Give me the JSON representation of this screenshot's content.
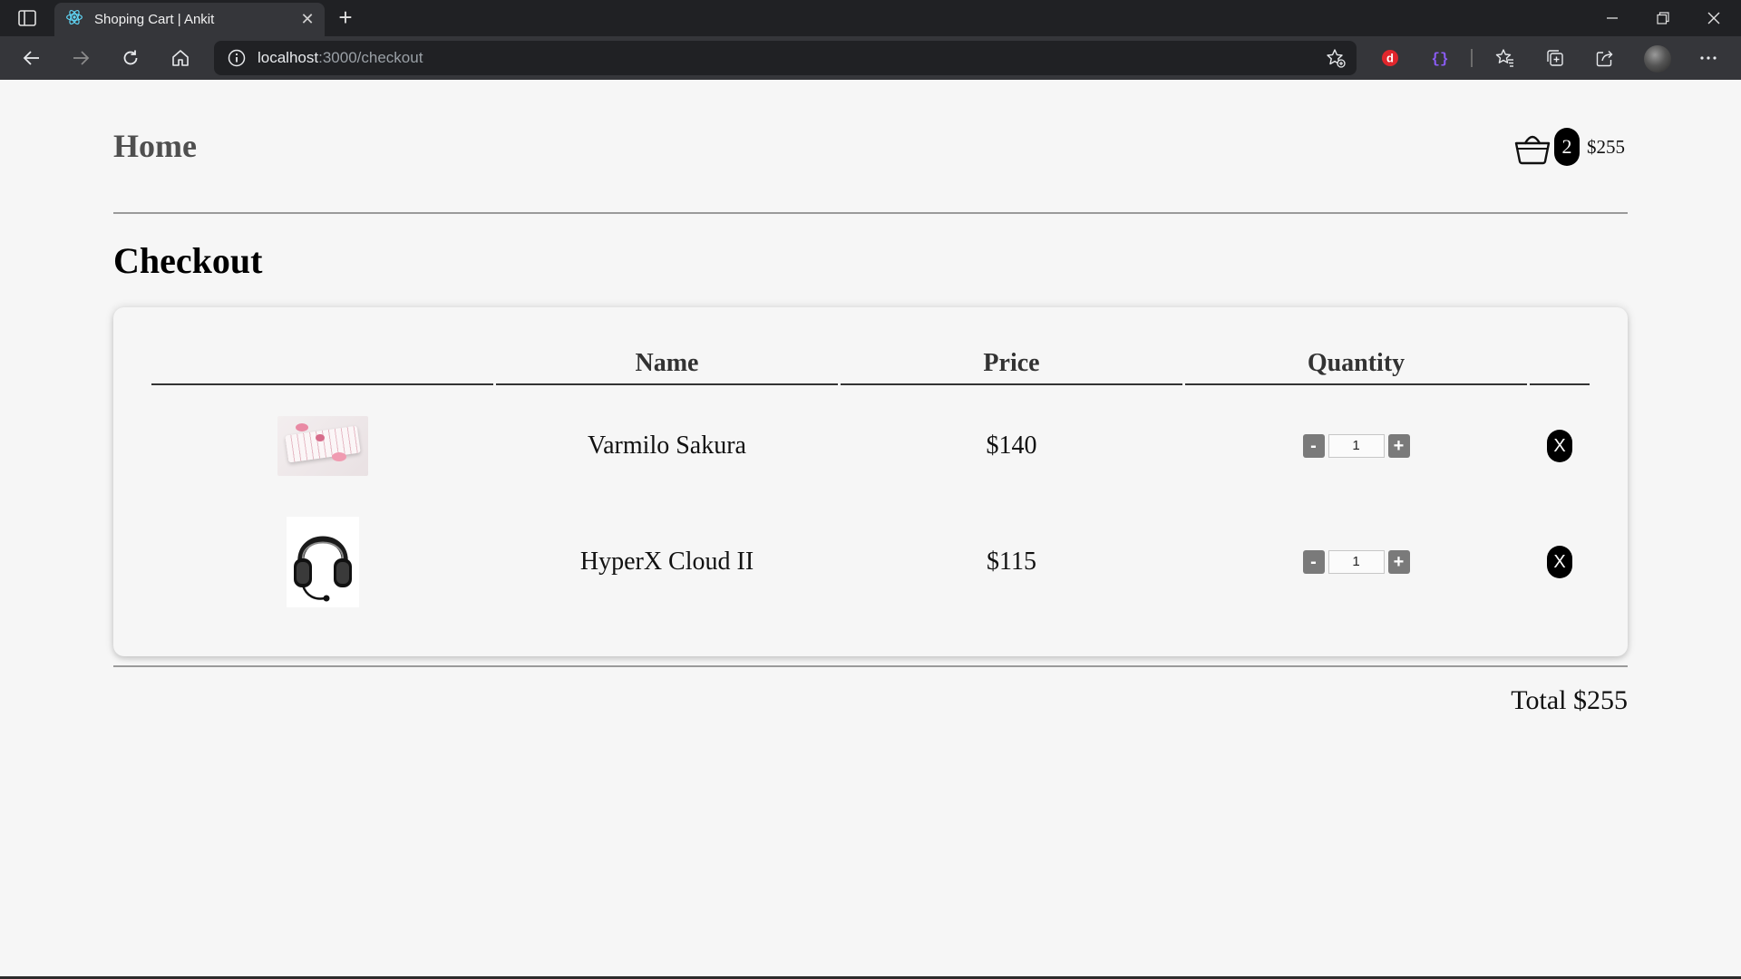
{
  "browser": {
    "tab_title": "Shoping Cart | Ankit",
    "tab_close": "✕",
    "new_tab": "+",
    "url_host": "localhost",
    "url_path": ":3000/checkout"
  },
  "header": {
    "home_label": "Home",
    "cart_count": "2",
    "cart_total": "$255"
  },
  "page": {
    "title": "Checkout"
  },
  "table": {
    "columns": [
      "",
      "Name",
      "Price",
      "Quantity",
      ""
    ],
    "rows": [
      {
        "name": "Varmilo Sakura",
        "price": "$140",
        "quantity": "1",
        "minus": "-",
        "plus": "+",
        "remove": "X"
      },
      {
        "name": "HyperX Cloud II",
        "price": "$115",
        "quantity": "1",
        "minus": "-",
        "plus": "+",
        "remove": "X"
      }
    ]
  },
  "summary": {
    "total_label": "Total $255"
  },
  "icons": {
    "tab_favicon": "react-icon",
    "basket": "basket-icon",
    "remove": "close-icon"
  },
  "colors": {
    "page_bg": "#f6f6f6",
    "chrome_bg": "#202124",
    "toolbar_bg": "#35363a",
    "badge_bg": "#000000",
    "qty_button": "#7a7a7a"
  }
}
